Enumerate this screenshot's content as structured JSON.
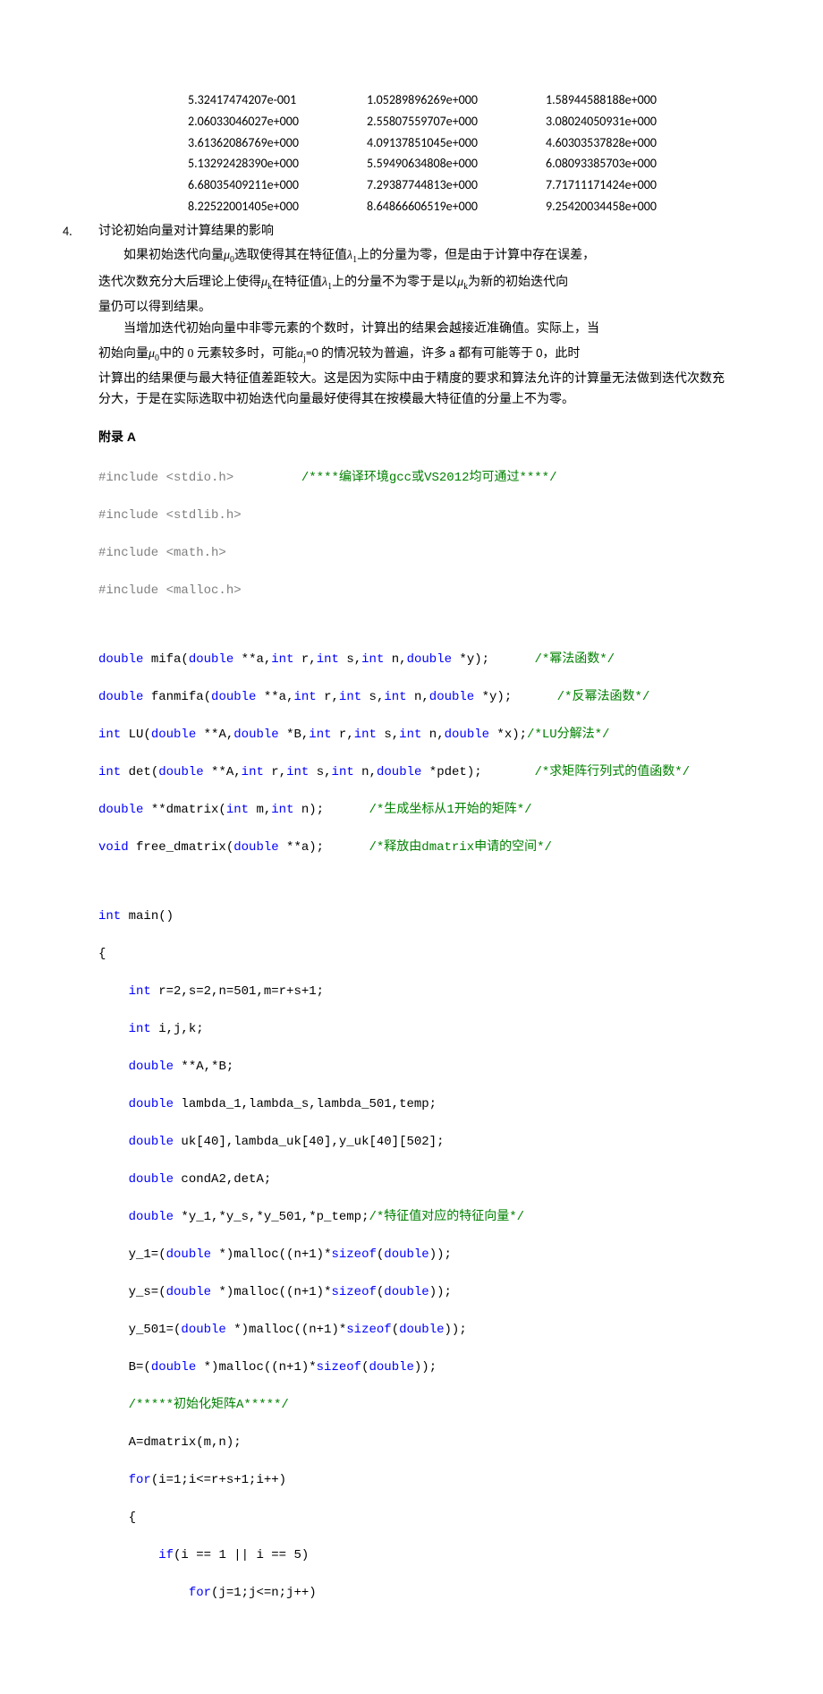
{
  "data_rows": [
    [
      "5.32417474207e-001",
      "1.05289896269e+000",
      "1.58944588188e+000"
    ],
    [
      "2.06033046027e+000",
      "2.55807559707e+000",
      "3.08024050931e+000"
    ],
    [
      "3.61362086769e+000",
      "4.09137851045e+000",
      "4.60303537828e+000"
    ],
    [
      "5.13292428390e+000",
      "5.59490634808e+000",
      "6.08093385703e+000"
    ],
    [
      "6.68035409211e+000",
      "7.29387744813e+000",
      "7.71711171424e+000"
    ],
    [
      "8.22522001405e+000",
      "8.64866606519e+000",
      "9.25420034458e+000"
    ]
  ],
  "sect4_num": "4.",
  "sect4_title": "讨论初始向量对计算结果的影响",
  "p1a": "如果初始迭代向量",
  "p1_mu0": "μ",
  "p1_mu0_sub": "0",
  "p1b": "选取使得其在特征值",
  "p1_l1": "λ",
  "p1_l1_sub": "1",
  "p1c": "上的分量为零，但是由于计算中存在误差，",
  "p2a": "迭代次数充分大后理论上使得",
  "p2_muk": "μ",
  "p2_muk_sub": "k",
  "p2b": "在特征值",
  "p2_l1": "λ",
  "p2_l1_sub": "1",
  "p2c": "上的分量不为零于是以",
  "p2_muk2": "μ",
  "p2_muk2_sub": "k",
  "p2d": "为新的初始迭代向",
  "p3": "量仍可以得到结果。",
  "p4": "当增加迭代初始向量中非零元素的个数时，计算出的结果会越接近准确值。实际上，当",
  "p5a": "初始向量",
  "p5_mu0": "μ",
  "p5_mu0_sub": "0",
  "p5b": "中的 0 元素较多时，可能",
  "p5_aj": "a",
  "p5_aj_sub": "j",
  "p5c": "=0 的情况较为普遍，许多 a 都有可能等于 0，此时",
  "p6": "计算出的结果便与最大特征值差距较大。这是因为实际中由于精度的要求和算法允许的计算量无法做到迭代次数充分大，于是在实际选取中初始迭代向量最好使得其在按模最大特征值的分量上不为零。",
  "appendix": "附录 A",
  "code_lines": [
    {
      "pre": "#include",
      "inc": " <stdio.h>",
      "pad": "         ",
      "cm": "/****编译环境gcc或VS2012均可通过****/"
    },
    {
      "pre": "#include",
      "inc": " <stdlib.h>"
    },
    {
      "pre": "#include",
      "inc": " <math.h>"
    },
    {
      "pre": "#include",
      "inc": " <malloc.h>"
    }
  ],
  "fn": {
    "mifa": {
      "t1": "double",
      "n": " mifa(",
      "t2": "double",
      "a2": " **a,",
      "t3": "int",
      "a3": " r,",
      "t4": "int",
      "a4": " s,",
      "t5": "int",
      "a5": " n,",
      "t6": "double",
      "a6": " *y);      ",
      "cm": "/*幂法函数*/"
    },
    "fanmifa": {
      "t1": "double",
      "n": " fanmifa(",
      "t2": "double",
      "a2": " **a,",
      "t3": "int",
      "a3": " r,",
      "t4": "int",
      "a4": " s,",
      "t5": "int",
      "a5": " n,",
      "t6": "double",
      "a6": " *y);      ",
      "cm": "/*反幂法函数*/"
    },
    "lu": {
      "t1": "int",
      "n": " LU(",
      "t2": "double",
      "a2": " **A,",
      "t3": "double",
      "a3": " *B,",
      "t4": "int",
      "a4": " r,",
      "t5": "int",
      "a5": " s,",
      "t6": "int",
      "a6": " n,",
      "t7": "double",
      "a7": " *x);",
      "cm": "/*LU分解法*/"
    },
    "det": {
      "t1": "int",
      "n": " det(",
      "t2": "double",
      "a2": " **A,",
      "t3": "int",
      "a3": " r,",
      "t4": "int",
      "a4": " s,",
      "t5": "int",
      "a5": " n,",
      "t6": "double",
      "a6": " *pdet);       ",
      "cm": "/*求矩阵行列式的值函数*/"
    },
    "dmat": {
      "t1": "double",
      "n": " **dmatrix(",
      "t2": "int",
      "a2": " m,",
      "t3": "int",
      "a3": " n);      ",
      "cm": "/*生成坐标从1开始的矩阵*/"
    },
    "free": {
      "t1": "void",
      "n": " free_dmatrix(",
      "t2": "double",
      "a2": " **a);      ",
      "cm": "/*释放由dmatrix申请的空间*/"
    }
  },
  "main": {
    "l1": {
      "t": "int",
      "rest": " main()"
    },
    "l2": "{",
    "l3": {
      "t": "int",
      "rest": " r=2,s=2,n=501,m=r+s+1;"
    },
    "l4": {
      "t": "int",
      "rest": " i,j,k;"
    },
    "l5": {
      "t": "double",
      "rest": " **A,*B;"
    },
    "l6": {
      "t": "double",
      "rest": " lambda_1,lambda_s,lambda_501,temp;"
    },
    "l7": {
      "t": "double",
      "rest": " uk[40],lambda_uk[40],y_uk[40][502];"
    },
    "l8": {
      "t": "double",
      "rest": " condA2,detA;"
    },
    "l9": {
      "t": "double",
      "rest": " *y_1,*y_s,*y_501,*p_temp;",
      "cm": "/*特征值对应的特征向量*/"
    },
    "l10": {
      "a": "    y_1=(",
      "t1": "double",
      "b": " *)malloc((n+1)*",
      "kw": "sizeof",
      "c": "(",
      "t2": "double",
      "d": "));"
    },
    "l11": {
      "a": "    y_s=(",
      "t1": "double",
      "b": " *)malloc((n+1)*",
      "kw": "sizeof",
      "c": "(",
      "t2": "double",
      "d": "));"
    },
    "l12": {
      "a": "    y_501=(",
      "t1": "double",
      "b": " *)malloc((n+1)*",
      "kw": "sizeof",
      "c": "(",
      "t2": "double",
      "d": "));"
    },
    "l13": {
      "a": "    B=(",
      "t1": "double",
      "b": " *)malloc((n+1)*",
      "kw": "sizeof",
      "c": "(",
      "t2": "double",
      "d": "));"
    },
    "l14": "/*****初始化矩阵A*****/",
    "l15": "    A=dmatrix(m,n);",
    "l16": {
      "kw": "for",
      "rest": "(i=1;i<=r+s+1;i++)"
    },
    "l17": "    {",
    "l18": {
      "kw": "if",
      "rest": "(i == 1 || i == 5)"
    },
    "l19": {
      "kw": "for",
      "rest": "(j=1;j<=n;j++)"
    }
  }
}
